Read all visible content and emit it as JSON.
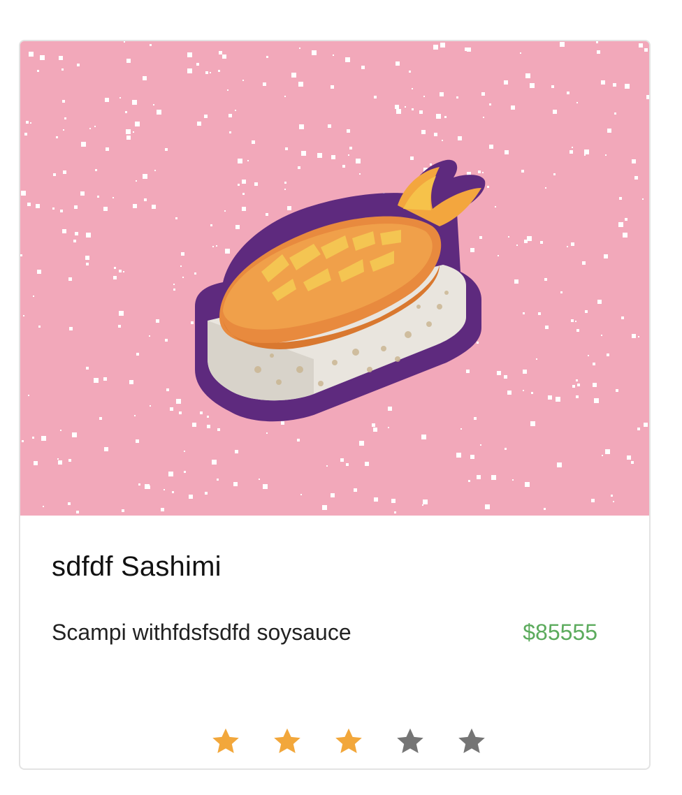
{
  "product": {
    "image_icon": "sushi-icon",
    "title": "sdfdf Sashimi",
    "description": "Scampi withfdsfsdfd soysauce",
    "price": "$85555"
  },
  "rating": {
    "value": 3,
    "max": 5,
    "filled_color": "#f2a73b",
    "empty_color": "#757575"
  },
  "colors": {
    "image_background": "#f2a8ba",
    "price": "#5cab5d"
  }
}
